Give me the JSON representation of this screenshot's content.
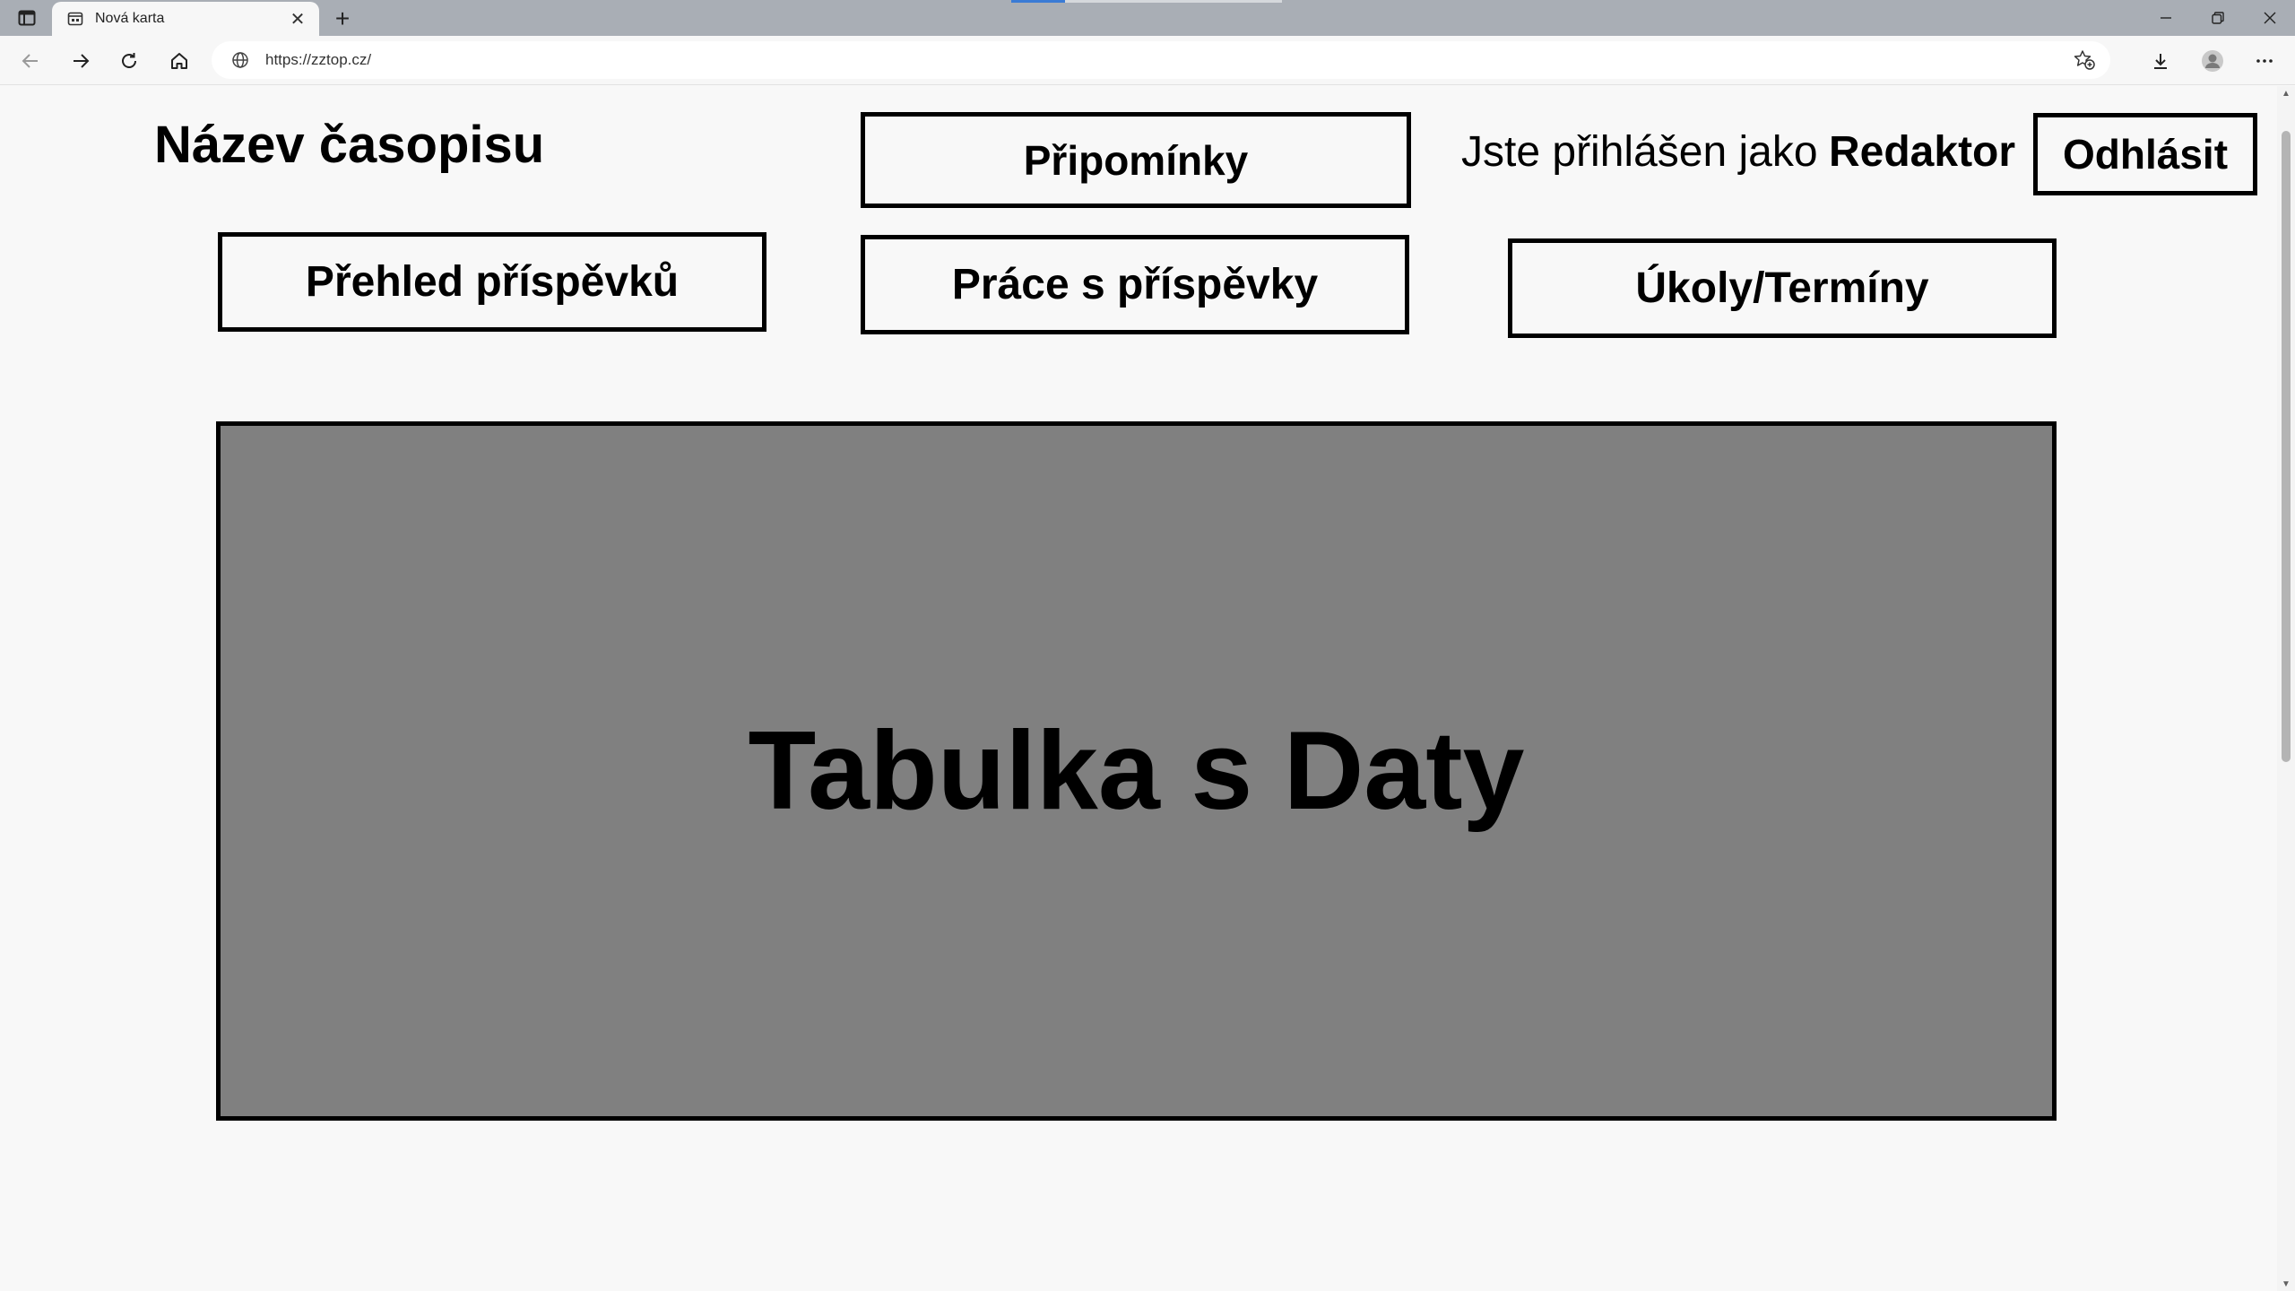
{
  "browser": {
    "tab_title": "Nová karta",
    "new_tab_symbol": "+",
    "address": "https://zztop.cz/",
    "icons": {
      "tab_actions": "tab-actions-icon",
      "tab_favicon": "new-tab-page-icon",
      "tab_close": "close-icon",
      "back": "arrow-left-icon",
      "forward": "arrow-right-icon",
      "reload": "reload-icon",
      "home": "home-icon",
      "site_info": "globe-icon",
      "favorites": "star-plus-icon",
      "downloads": "download-icon",
      "profile": "profile-icon",
      "menu": "more-icon",
      "minimize": "minimize-icon",
      "restore": "restore-icon",
      "close_window": "close-icon"
    }
  },
  "header": {
    "journal_title": "Název časopisu",
    "logged_in_as": "Jste přihlášen jako",
    "role": "Redaktor"
  },
  "buttons": {
    "comments": "Připomínky",
    "logout": "Odhlásit",
    "overview": "Přehled příspěvků",
    "work": "Práce s příspěvky",
    "tasks": "Úkoly/Termíny"
  },
  "main": {
    "data_panel_label": "Tabulka s Daty"
  },
  "colors": {
    "page_background": "#f8f8f8",
    "panel_fill": "#808080",
    "border": "#000000",
    "titlebar": "#a9aeb5"
  }
}
